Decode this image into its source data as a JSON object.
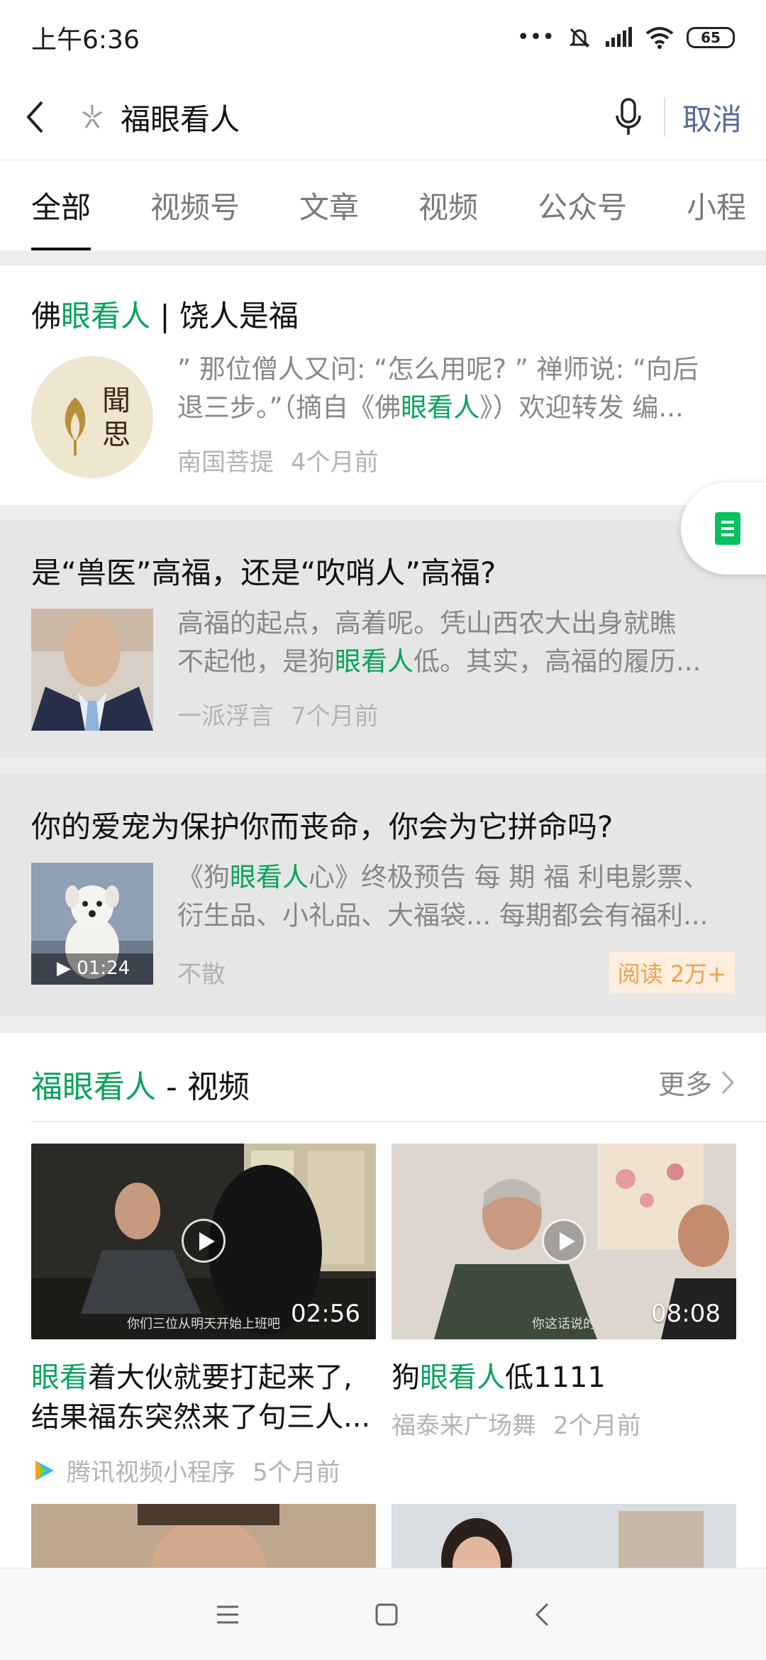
{
  "status_bar": {
    "time": "上午6:36",
    "battery": "65"
  },
  "search": {
    "query": "福眼看人",
    "cancel_label": "取消"
  },
  "tabs": [
    {
      "label": "全部",
      "active": true
    },
    {
      "label": "视频号"
    },
    {
      "label": "文章"
    },
    {
      "label": "视频"
    },
    {
      "label": "公众号"
    },
    {
      "label": "小程"
    }
  ],
  "results": [
    {
      "title_a": "佛",
      "title_hl": "眼看人",
      "title_b": " | 饶人是福",
      "desc1": "” 那位僧人又问: “怎么用呢? ” 禅师说: “向后",
      "desc2a": "退三步。”（摘自《佛",
      "desc2hl": "眼看人",
      "desc2b": "》）欢迎转发 编...",
      "logo_text_1": "聞",
      "logo_text_2": "思",
      "source": "南国菩提",
      "time": "4个月前"
    },
    {
      "title": "是“兽医”高福，还是“吹哨人”高福?",
      "desc1": "高福的起点，高着呢。凭山西农大出身就瞧",
      "desc2a": "不起他，是狗",
      "desc2hl": "眼看人",
      "desc2b": "低。其实，高福的履历...",
      "source": "一派浮言",
      "time": "7个月前"
    },
    {
      "title": "你的爱宠为保护你而丧命，你会为它拼命吗?",
      "desc1a": "《狗",
      "desc1hl": "眼看人",
      "desc1b": "心》终极预告 每 期 福 利电影票、",
      "desc2": "衍生品、小礼品、大福袋... 每期都会有福利...",
      "duration": "▶ 01:24",
      "source": "不散",
      "reads": "阅读 2万+"
    }
  ],
  "video_section": {
    "title_hl": "福眼看人",
    "title_rest": " - 视频",
    "more_label": "更多",
    "videos": [
      {
        "duration": "02:56",
        "subtitle": "你们三位从明天开始上班吧",
        "title1_hl": "眼看",
        "title1_rest": "着大伙就要打起来了,",
        "title2": "结果福东突然来了句三人...",
        "source": "腾讯视频小程序",
        "time": "5个月前"
      },
      {
        "duration": "08:08",
        "subtitle": "你这话说的",
        "title_a": "狗",
        "title_hl": "眼看人",
        "title_b": "低1111",
        "source": "福泰来广场舞",
        "time": "2个月前"
      }
    ]
  }
}
